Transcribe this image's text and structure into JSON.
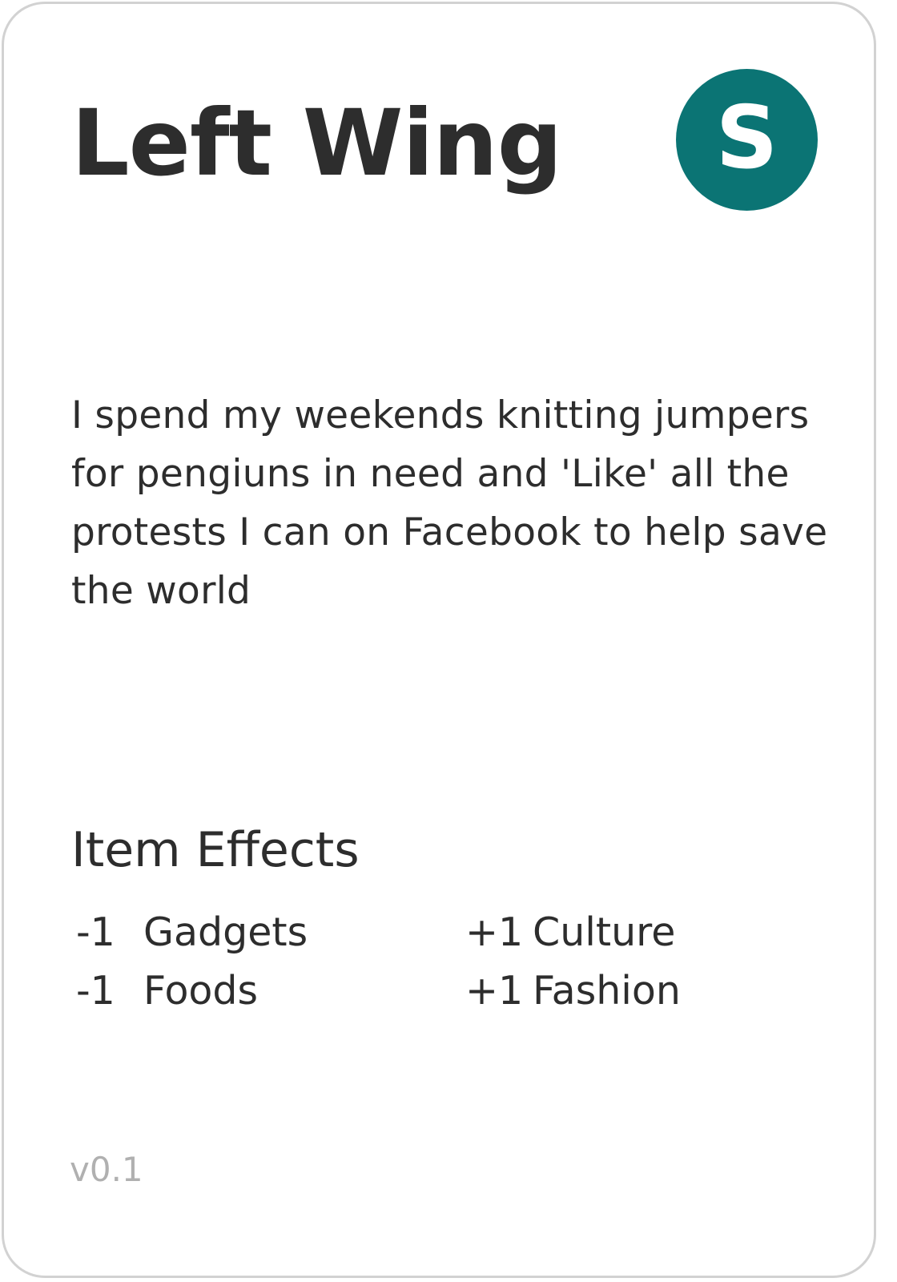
{
  "card": {
    "title": "Left Wing",
    "badge_letter": "S",
    "badge_color": "#0b7474",
    "description": "I spend my weekends knitting jumpers for pengiuns in need and 'Like' all the protests I can on Facebook to help save the world",
    "effects_heading": "Item Effects",
    "effects": [
      {
        "value": "-1",
        "label": "Gadgets"
      },
      {
        "value": "-1",
        "label": "Foods"
      },
      {
        "value": "+1",
        "label": "Culture"
      },
      {
        "value": "+1",
        "label": "Fashion"
      }
    ],
    "version": "v0.1"
  }
}
